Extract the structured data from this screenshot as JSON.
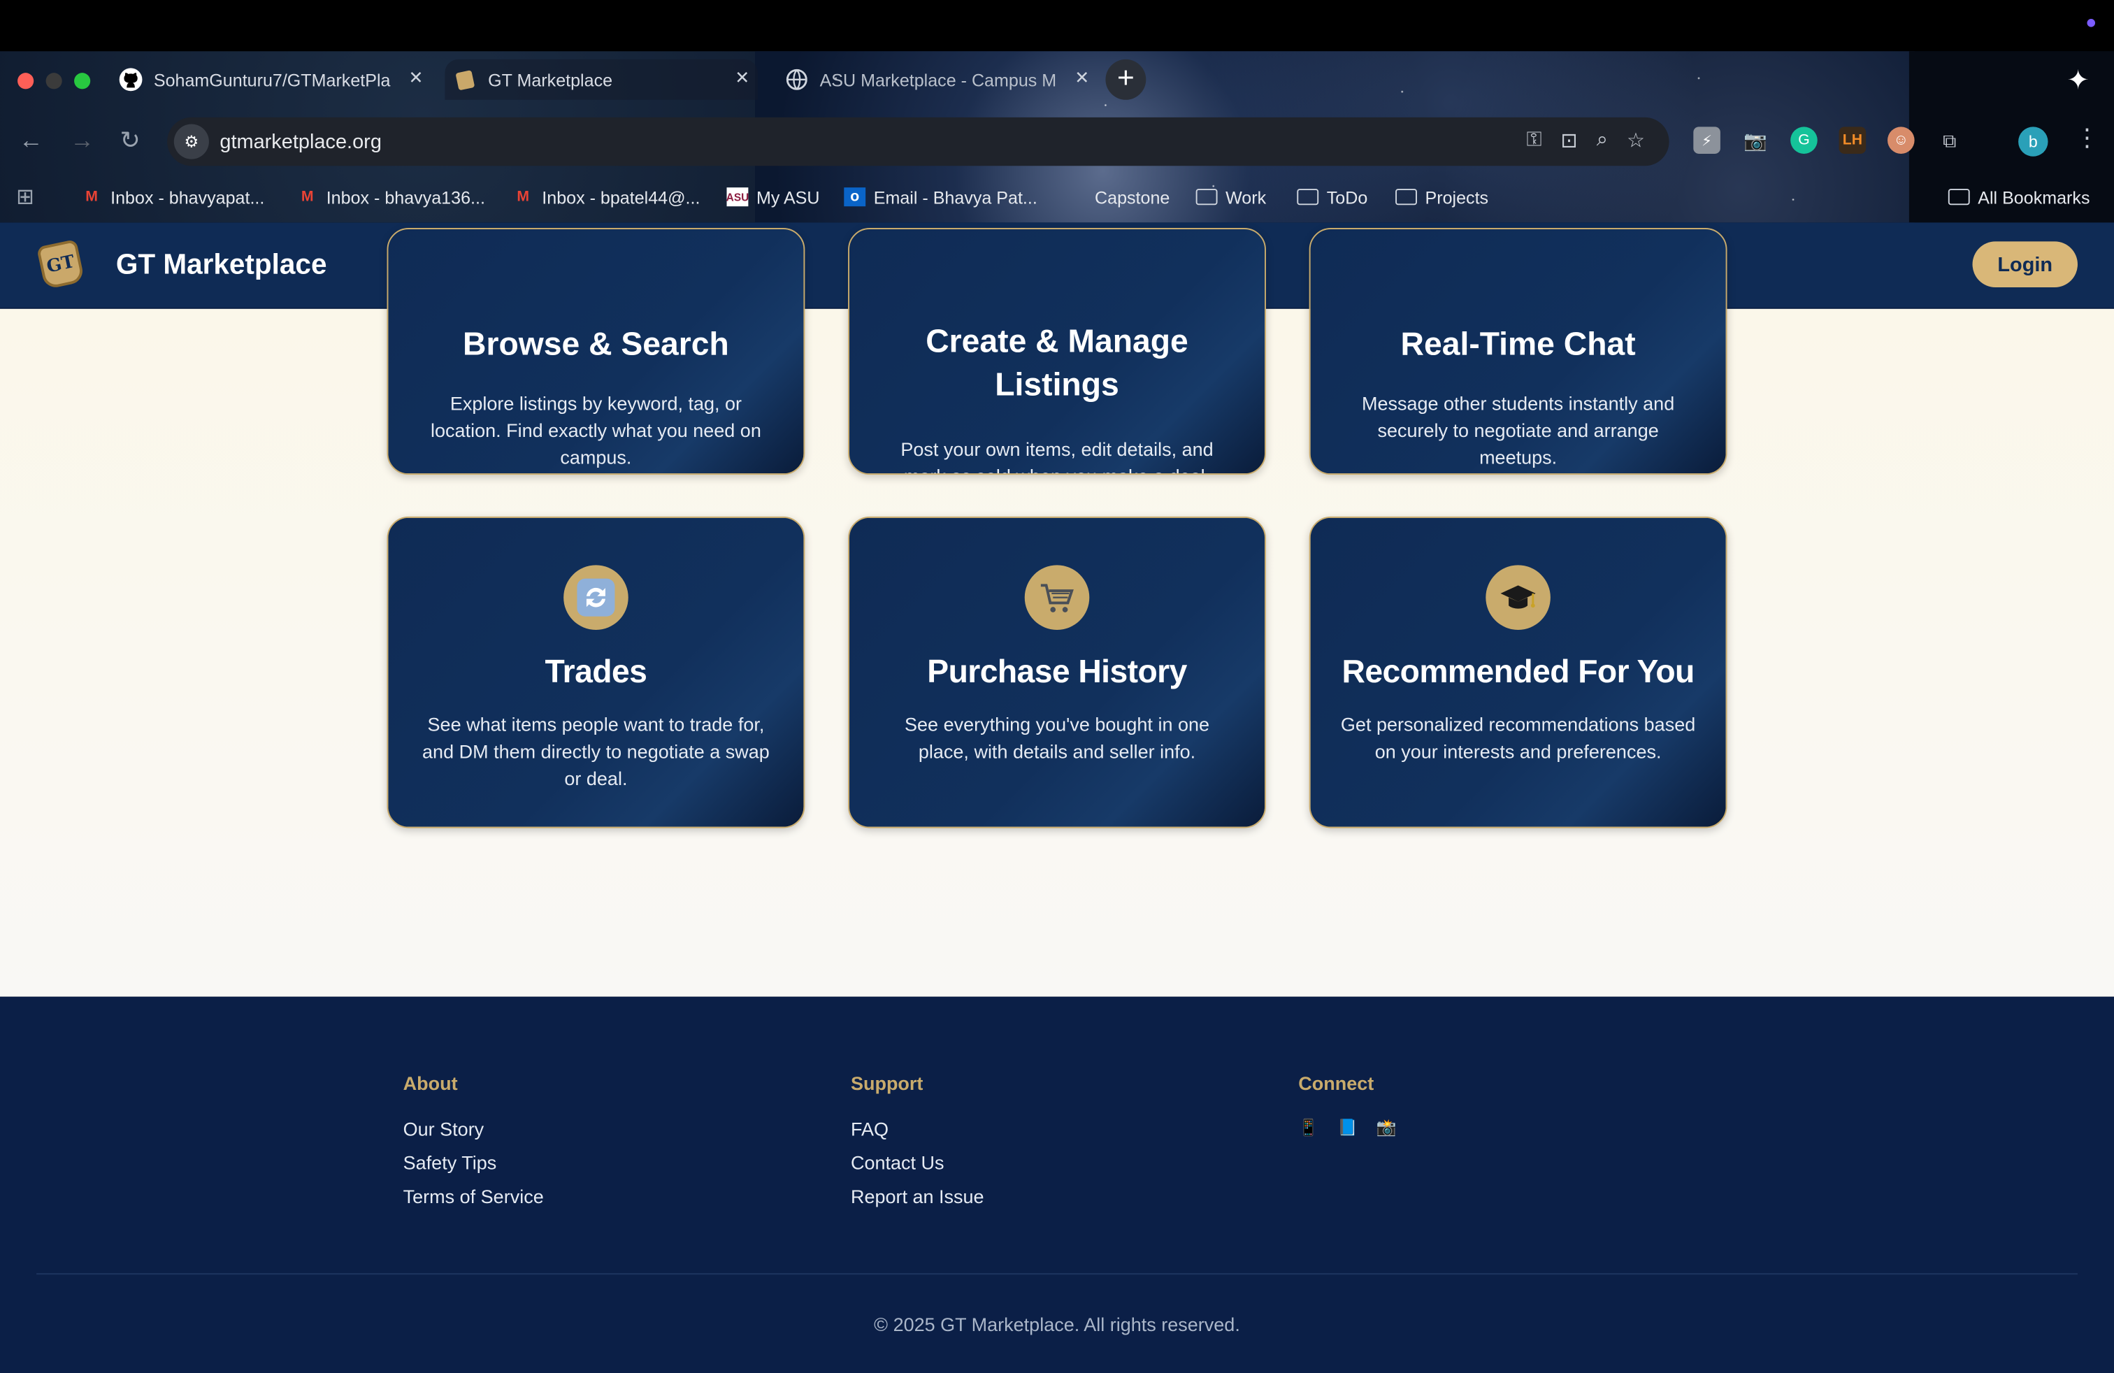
{
  "browser": {
    "tabs": [
      {
        "title": "SohamGunturu7/GTMarketPla",
        "icon": "github-icon"
      },
      {
        "title": "GT Marketplace",
        "icon": "gt-logo-icon"
      },
      {
        "title": "ASU Marketplace - Campus M",
        "icon": "globe-icon"
      }
    ],
    "url": "gtmarketplace.org",
    "profile_initial": "b",
    "bookmarks": [
      {
        "label": "Inbox - bhavyapat...",
        "icon": "gmail-icon"
      },
      {
        "label": "Inbox - bhavya136...",
        "icon": "gmail-icon"
      },
      {
        "label": "Inbox - bpatel44@...",
        "icon": "gmail-icon"
      },
      {
        "label": "My ASU",
        "icon": "asu-icon"
      },
      {
        "label": "Email - Bhavya Pat...",
        "icon": "outlook-icon"
      },
      {
        "label": "Capstone",
        "icon": "none"
      },
      {
        "label": "Work",
        "icon": "folder-icon"
      },
      {
        "label": "ToDo",
        "icon": "folder-icon"
      },
      {
        "label": "Projects",
        "icon": "folder-icon"
      }
    ],
    "all_bookmarks": "All Bookmarks"
  },
  "header": {
    "logo_text": "GT",
    "site_name": "GT Marketplace",
    "login_label": "Login"
  },
  "features": {
    "row1": [
      {
        "title": "Browse & Search",
        "desc": "Explore listings by keyword, tag, or location. Find exactly what you need on campus."
      },
      {
        "title_line1": "Create & Manage",
        "title_line2": "Listings",
        "desc": "Post your own items, edit details, and mark as sold when you make a deal."
      },
      {
        "title": "Real-Time Chat",
        "desc": "Message other students instantly and securely to negotiate and arrange meetups."
      }
    ],
    "row2": [
      {
        "title": "Trades",
        "icon": "refresh-icon",
        "desc": "See what items people want to trade for, and DM them directly to negotiate a swap or deal."
      },
      {
        "title": "Purchase History",
        "icon": "shopping-cart-icon",
        "desc": "See everything you've bought in one place, with details and seller info."
      },
      {
        "title": "Recommended For You",
        "icon": "graduation-cap-icon",
        "desc": "Get personalized recommendations based on your interests and preferences."
      }
    ]
  },
  "footer": {
    "about": {
      "heading": "About",
      "links": [
        "Our Story",
        "Safety Tips",
        "Terms of Service"
      ]
    },
    "support": {
      "heading": "Support",
      "links": [
        "FAQ",
        "Contact Us",
        "Report an Issue"
      ]
    },
    "connect": {
      "heading": "Connect",
      "icons": [
        "phone-icon",
        "book-icon",
        "camera-icon"
      ]
    },
    "copyright": "© 2025 GT Marketplace. All rights reserved."
  }
}
